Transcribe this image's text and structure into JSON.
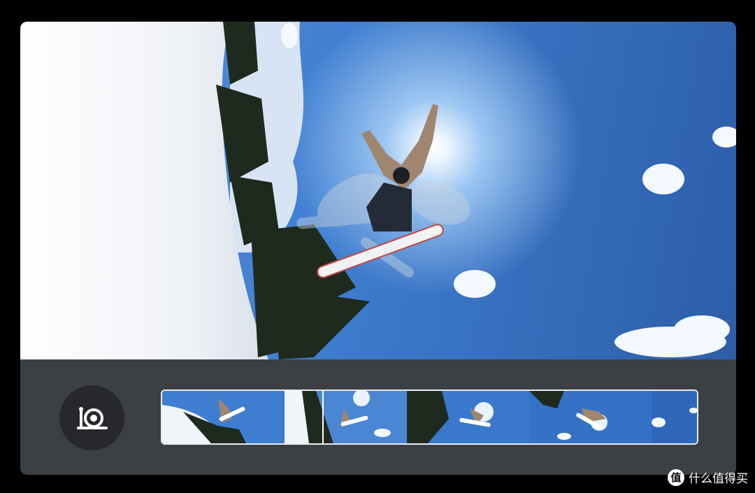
{
  "preview": {
    "description_icon": "video-preview",
    "sky_color": "#3f7dd0",
    "snow_color": "#f2f4f8"
  },
  "controls": {
    "slowmo_icon": "snail-icon"
  },
  "timeline": {
    "frame_count": 5,
    "playhead_icon": "playhead"
  },
  "watermark": {
    "logo_text": "值",
    "text": "什么值得买"
  }
}
